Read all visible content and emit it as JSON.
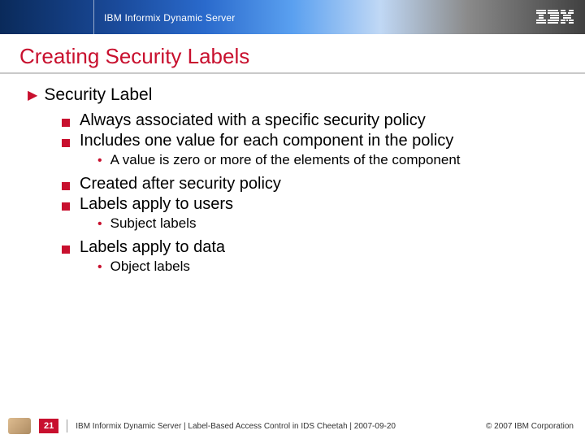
{
  "header": {
    "product": "IBM Informix Dynamic Server",
    "logo_alt": "IBM"
  },
  "title": "Creating Security Labels",
  "bullets": {
    "l1": "Security Label",
    "l2a": "Always associated with a specific security policy",
    "l2b": "Includes one value for each component in the policy",
    "l3a": "A value is zero or more of the elements of the component",
    "l2c": "Created after security policy",
    "l2d": "Labels apply to users",
    "l3b": "Subject labels",
    "l2e": "Labels apply to data",
    "l3c": "Object labels"
  },
  "footer": {
    "page": "21",
    "text": "IBM Informix Dynamic Server  |  Label-Based Access Control in IDS Cheetah | 2007-09-20",
    "copyright": "© 2007 IBM Corporation"
  }
}
